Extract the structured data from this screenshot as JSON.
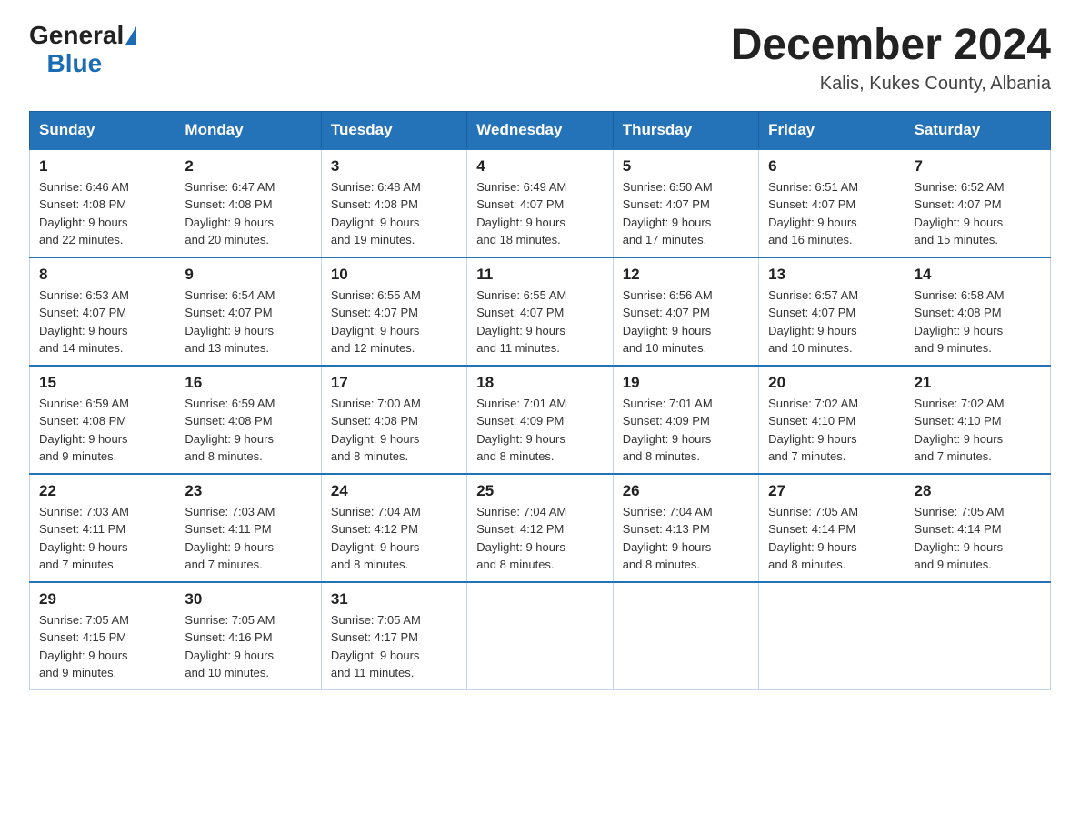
{
  "logo": {
    "general": "General",
    "blue": "Blue"
  },
  "header": {
    "title": "December 2024",
    "subtitle": "Kalis, Kukes County, Albania"
  },
  "days": [
    "Sunday",
    "Monday",
    "Tuesday",
    "Wednesday",
    "Thursday",
    "Friday",
    "Saturday"
  ],
  "weeks": [
    [
      {
        "num": "1",
        "sunrise": "6:46 AM",
        "sunset": "4:08 PM",
        "daylight": "9 hours and 22 minutes."
      },
      {
        "num": "2",
        "sunrise": "6:47 AM",
        "sunset": "4:08 PM",
        "daylight": "9 hours and 20 minutes."
      },
      {
        "num": "3",
        "sunrise": "6:48 AM",
        "sunset": "4:08 PM",
        "daylight": "9 hours and 19 minutes."
      },
      {
        "num": "4",
        "sunrise": "6:49 AM",
        "sunset": "4:07 PM",
        "daylight": "9 hours and 18 minutes."
      },
      {
        "num": "5",
        "sunrise": "6:50 AM",
        "sunset": "4:07 PM",
        "daylight": "9 hours and 17 minutes."
      },
      {
        "num": "6",
        "sunrise": "6:51 AM",
        "sunset": "4:07 PM",
        "daylight": "9 hours and 16 minutes."
      },
      {
        "num": "7",
        "sunrise": "6:52 AM",
        "sunset": "4:07 PM",
        "daylight": "9 hours and 15 minutes."
      }
    ],
    [
      {
        "num": "8",
        "sunrise": "6:53 AM",
        "sunset": "4:07 PM",
        "daylight": "9 hours and 14 minutes."
      },
      {
        "num": "9",
        "sunrise": "6:54 AM",
        "sunset": "4:07 PM",
        "daylight": "9 hours and 13 minutes."
      },
      {
        "num": "10",
        "sunrise": "6:55 AM",
        "sunset": "4:07 PM",
        "daylight": "9 hours and 12 minutes."
      },
      {
        "num": "11",
        "sunrise": "6:55 AM",
        "sunset": "4:07 PM",
        "daylight": "9 hours and 11 minutes."
      },
      {
        "num": "12",
        "sunrise": "6:56 AM",
        "sunset": "4:07 PM",
        "daylight": "9 hours and 10 minutes."
      },
      {
        "num": "13",
        "sunrise": "6:57 AM",
        "sunset": "4:07 PM",
        "daylight": "9 hours and 10 minutes."
      },
      {
        "num": "14",
        "sunrise": "6:58 AM",
        "sunset": "4:08 PM",
        "daylight": "9 hours and 9 minutes."
      }
    ],
    [
      {
        "num": "15",
        "sunrise": "6:59 AM",
        "sunset": "4:08 PM",
        "daylight": "9 hours and 9 minutes."
      },
      {
        "num": "16",
        "sunrise": "6:59 AM",
        "sunset": "4:08 PM",
        "daylight": "9 hours and 8 minutes."
      },
      {
        "num": "17",
        "sunrise": "7:00 AM",
        "sunset": "4:08 PM",
        "daylight": "9 hours and 8 minutes."
      },
      {
        "num": "18",
        "sunrise": "7:01 AM",
        "sunset": "4:09 PM",
        "daylight": "9 hours and 8 minutes."
      },
      {
        "num": "19",
        "sunrise": "7:01 AM",
        "sunset": "4:09 PM",
        "daylight": "9 hours and 8 minutes."
      },
      {
        "num": "20",
        "sunrise": "7:02 AM",
        "sunset": "4:10 PM",
        "daylight": "9 hours and 7 minutes."
      },
      {
        "num": "21",
        "sunrise": "7:02 AM",
        "sunset": "4:10 PM",
        "daylight": "9 hours and 7 minutes."
      }
    ],
    [
      {
        "num": "22",
        "sunrise": "7:03 AM",
        "sunset": "4:11 PM",
        "daylight": "9 hours and 7 minutes."
      },
      {
        "num": "23",
        "sunrise": "7:03 AM",
        "sunset": "4:11 PM",
        "daylight": "9 hours and 7 minutes."
      },
      {
        "num": "24",
        "sunrise": "7:04 AM",
        "sunset": "4:12 PM",
        "daylight": "9 hours and 8 minutes."
      },
      {
        "num": "25",
        "sunrise": "7:04 AM",
        "sunset": "4:12 PM",
        "daylight": "9 hours and 8 minutes."
      },
      {
        "num": "26",
        "sunrise": "7:04 AM",
        "sunset": "4:13 PM",
        "daylight": "9 hours and 8 minutes."
      },
      {
        "num": "27",
        "sunrise": "7:05 AM",
        "sunset": "4:14 PM",
        "daylight": "9 hours and 8 minutes."
      },
      {
        "num": "28",
        "sunrise": "7:05 AM",
        "sunset": "4:14 PM",
        "daylight": "9 hours and 9 minutes."
      }
    ],
    [
      {
        "num": "29",
        "sunrise": "7:05 AM",
        "sunset": "4:15 PM",
        "daylight": "9 hours and 9 minutes."
      },
      {
        "num": "30",
        "sunrise": "7:05 AM",
        "sunset": "4:16 PM",
        "daylight": "9 hours and 10 minutes."
      },
      {
        "num": "31",
        "sunrise": "7:05 AM",
        "sunset": "4:17 PM",
        "daylight": "9 hours and 11 minutes."
      },
      null,
      null,
      null,
      null
    ]
  ],
  "labels": {
    "sunrise": "Sunrise:",
    "sunset": "Sunset:",
    "daylight": "Daylight:"
  }
}
